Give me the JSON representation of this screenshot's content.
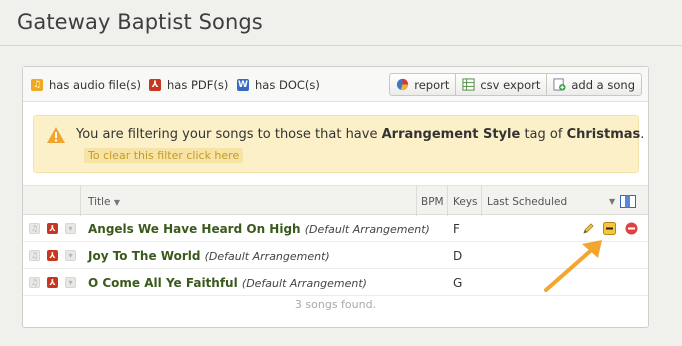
{
  "header": {
    "title": "Gateway Baptist Songs"
  },
  "legend": {
    "audio": "has audio file(s)",
    "pdf": "has PDF(s)",
    "doc": "has DOC(s)"
  },
  "toolbar": {
    "report": "report",
    "csv_export": "csv export",
    "add_song": "add a song"
  },
  "alert": {
    "prefix": "You are filtering your songs to those that have ",
    "tag_label": "Arrangement Style",
    "middle": " tag of ",
    "tag_value": "Christmas",
    "suffix": ".",
    "clear_link": "To clear this filter click here"
  },
  "table": {
    "columns": {
      "title": "Title",
      "bpm": "BPM",
      "keys": "Keys",
      "last_scheduled": "Last Scheduled"
    },
    "rows": [
      {
        "title": "Angels We Have Heard On High",
        "arrangement": "(Default Arrangement)",
        "key": "F"
      },
      {
        "title": "Joy To The World",
        "arrangement": "(Default Arrangement)",
        "key": "D"
      },
      {
        "title": "O Come All Ye Faithful",
        "arrangement": "(Default Arrangement)",
        "key": "G"
      }
    ],
    "footer": "3 songs found."
  },
  "colors": {
    "accent_arrow": "#f2a630",
    "alert_bg": "#fcf0c8",
    "title_green": "#3a5a1c"
  }
}
